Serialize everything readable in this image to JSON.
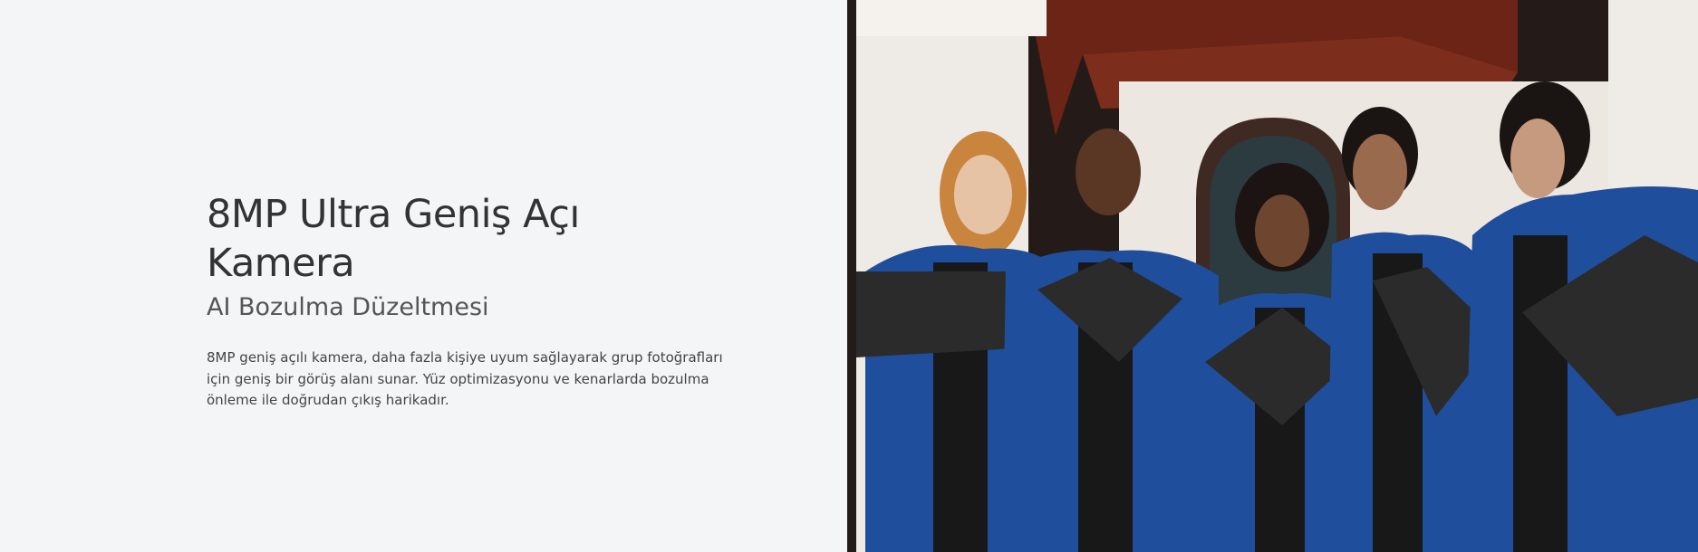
{
  "section": {
    "title": "8MP Ultra Geniş Açı Kamera",
    "subtitle": "AI Bozulma Düzeltmesi",
    "description": "8MP geniş açılı kamera, daha fazla kişiye uyum sağlayarak grup fotoğrafları için geniş bir görüş alanı sunar. Yüz optimizasyonu ve kenarlarda bozulma önleme ile doğrudan çıkış harikadır."
  },
  "colors": {
    "background": "#f4f5f6",
    "title": "#333333",
    "gown": "#1f4f9c"
  }
}
